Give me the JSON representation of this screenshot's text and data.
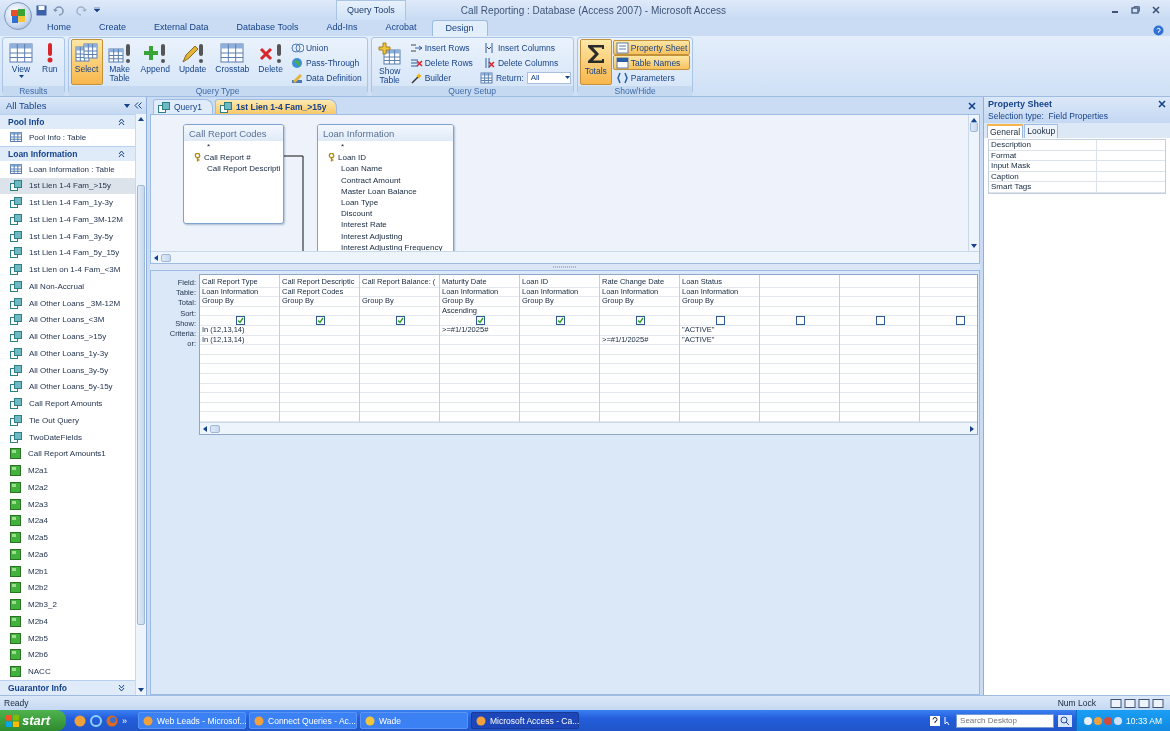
{
  "title_bar": {
    "title": "Call Reporting : Database (Access 2007) - Microsoft Access",
    "context_label": "Query Tools"
  },
  "ribbon": {
    "tabs": [
      {
        "label": "Home",
        "selected": false
      },
      {
        "label": "Create",
        "selected": false
      },
      {
        "label": "External Data",
        "selected": false
      },
      {
        "label": "Database Tools",
        "selected": false
      },
      {
        "label": "Add-Ins",
        "selected": false
      },
      {
        "label": "Acrobat",
        "selected": false
      },
      {
        "label": "Design",
        "selected": true
      }
    ],
    "groups": [
      {
        "label": "Results",
        "buttons": [
          {
            "kind": "large",
            "label": "View",
            "dropdown": true,
            "selected": false
          },
          {
            "kind": "large",
            "label": "Run",
            "selected": false
          }
        ]
      },
      {
        "label": "Query Type",
        "buttons": [
          {
            "kind": "large",
            "label": "Select",
            "selected": true
          },
          {
            "kind": "large",
            "label": "Make Table",
            "selected": false
          },
          {
            "kind": "large",
            "label": "Append",
            "selected": false
          },
          {
            "kind": "large",
            "label": "Update",
            "selected": false
          },
          {
            "kind": "large",
            "label": "Crosstab",
            "selected": false
          },
          {
            "kind": "large",
            "label": "Delete",
            "selected": false
          },
          {
            "kind": "small",
            "label": "Union",
            "selected": false
          },
          {
            "kind": "small",
            "label": "Pass-Through",
            "selected": false
          },
          {
            "kind": "small",
            "label": "Data Definition",
            "selected": false
          }
        ]
      },
      {
        "label": "Query Setup",
        "buttons": [
          {
            "kind": "large",
            "label": "Show Table",
            "selected": false
          },
          {
            "kind": "small",
            "label": "Insert Rows",
            "selected": false
          },
          {
            "kind": "small",
            "label": "Delete Rows",
            "selected": false
          },
          {
            "kind": "small",
            "label": "Builder",
            "selected": false
          },
          {
            "kind": "small",
            "label": "Insert Columns",
            "selected": false
          },
          {
            "kind": "small",
            "label": "Delete Columns",
            "selected": false
          },
          {
            "kind": "combo",
            "label": "Return:",
            "value": "All"
          }
        ]
      },
      {
        "label": "Show/Hide",
        "buttons": [
          {
            "kind": "large",
            "label": "Totals",
            "selected": true
          },
          {
            "kind": "small",
            "label": "Property Sheet",
            "selected": true
          },
          {
            "kind": "small",
            "label": "Table Names",
            "selected": true
          },
          {
            "kind": "small",
            "label": "Parameters",
            "selected": false
          }
        ]
      }
    ]
  },
  "nav": {
    "header": "All Tables",
    "groups": [
      {
        "label": "Pool Info",
        "expanded": true,
        "items": [
          {
            "label": "Pool Info : Table",
            "kind": "table",
            "selected": false
          }
        ]
      },
      {
        "label": "Loan Information",
        "expanded": true,
        "items": [
          {
            "label": "Loan Information : Table",
            "kind": "table",
            "selected": false
          },
          {
            "label": "1st Lien 1-4 Fam_>15y",
            "kind": "query",
            "selected": true
          },
          {
            "label": "1st Lien 1-4 Fam_1y-3y",
            "kind": "query",
            "selected": false
          },
          {
            "label": "1st Lien 1-4 Fam_3M-12M",
            "kind": "query",
            "selected": false
          },
          {
            "label": "1st Lien 1-4 Fam_3y-5y",
            "kind": "query",
            "selected": false
          },
          {
            "label": "1st Lien 1-4 Fam_5y_15y",
            "kind": "query",
            "selected": false
          },
          {
            "label": "1st Lien on 1-4 Fam_<3M",
            "kind": "query",
            "selected": false
          },
          {
            "label": "All Non-Accrual",
            "kind": "query",
            "selected": false
          },
          {
            "label": "All Other Loans _3M-12M",
            "kind": "query",
            "selected": false
          },
          {
            "label": "All Other Loans_<3M",
            "kind": "query",
            "selected": false
          },
          {
            "label": "All Other Loans_>15y",
            "kind": "query",
            "selected": false
          },
          {
            "label": "All Other Loans_1y-3y",
            "kind": "query",
            "selected": false
          },
          {
            "label": "All Other Loans_3y-5y",
            "kind": "query",
            "selected": false
          },
          {
            "label": "All Other Loans_5y-15y",
            "kind": "query",
            "selected": false
          },
          {
            "label": "Call Report Amounts",
            "kind": "query",
            "selected": false
          },
          {
            "label": "Tie Out Query",
            "kind": "query",
            "selected": false
          },
          {
            "label": "TwoDateFields",
            "kind": "query",
            "selected": false
          },
          {
            "label": "Call Report Amounts1",
            "kind": "report",
            "selected": false
          },
          {
            "label": "M2a1",
            "kind": "report",
            "selected": false
          },
          {
            "label": "M2a2",
            "kind": "report",
            "selected": false
          },
          {
            "label": "M2a3",
            "kind": "report",
            "selected": false
          },
          {
            "label": "M2a4",
            "kind": "report",
            "selected": false
          },
          {
            "label": "M2a5",
            "kind": "report",
            "selected": false
          },
          {
            "label": "M2a6",
            "kind": "report",
            "selected": false
          },
          {
            "label": "M2b1",
            "kind": "report",
            "selected": false
          },
          {
            "label": "M2b2",
            "kind": "report",
            "selected": false
          },
          {
            "label": "M2b3_2",
            "kind": "report",
            "selected": false
          },
          {
            "label": "M2b4",
            "kind": "report",
            "selected": false
          },
          {
            "label": "M2b5",
            "kind": "report",
            "selected": false
          },
          {
            "label": "M2b6",
            "kind": "report",
            "selected": false
          },
          {
            "label": "NACC",
            "kind": "report",
            "selected": false
          }
        ]
      },
      {
        "label": "Guarantor Info",
        "expanded": false
      }
    ]
  },
  "doc_tabs": [
    {
      "label": "Query1",
      "selected": false
    },
    {
      "label": "1st Lien 1-4 Fam_>15y",
      "selected": true
    }
  ],
  "field_lists": [
    {
      "title": "Call Report Codes",
      "fields": [
        {
          "name": "*",
          "key": false
        },
        {
          "name": "Call Report #",
          "key": true
        },
        {
          "name": "Call Report Descripti",
          "key": false
        }
      ]
    },
    {
      "title": "Loan Information",
      "fields": [
        {
          "name": "*",
          "key": false
        },
        {
          "name": "Loan ID",
          "key": true
        },
        {
          "name": "Loan Name",
          "key": false
        },
        {
          "name": "Contract Amount",
          "key": false
        },
        {
          "name": "Master Loan Balance",
          "key": false
        },
        {
          "name": "Loan Type",
          "key": false
        },
        {
          "name": "Discount",
          "key": false
        },
        {
          "name": "Interest Rate",
          "key": false
        },
        {
          "name": "Interest Adjusting",
          "key": false
        },
        {
          "name": "Interest Adjusting Frequency",
          "key": false
        }
      ]
    }
  ],
  "query_grid": {
    "row_labels": [
      "Field:",
      "Table:",
      "Total:",
      "Sort:",
      "Show:",
      "Criteria:",
      "or:"
    ],
    "columns": [
      {
        "field": "Call Report Type",
        "table": "Loan Information",
        "total": "Group By",
        "show": true,
        "criteria": "In (12,13,14)",
        "or": "In (12,13,14)"
      },
      {
        "field": "Call Report Descriptic",
        "table": "Call Report Codes",
        "total": "Group By",
        "show": true
      },
      {
        "field": "Call Report Balance: (",
        "total": "Group By",
        "show": true
      },
      {
        "field": "Maturity Date",
        "table": "Loan Information",
        "total": "Group By",
        "sort": "Ascending",
        "show": true,
        "criteria": ">=#1/1/2025#"
      },
      {
        "field": "Loan ID",
        "table": "Loan Information",
        "total": "Group By",
        "show": true
      },
      {
        "field": "Rate Change Date",
        "table": "Loan Information",
        "total": "Group By",
        "show": true,
        "or": ">=#1/1/2025#"
      },
      {
        "field": "Loan Status",
        "table": "Loan Information",
        "total": "Group By",
        "show": false,
        "criteria": "\"ACTIVE\"",
        "or": "\"ACTIVE\""
      },
      {
        "show": false
      },
      {
        "show": false
      },
      {
        "show": false
      }
    ]
  },
  "property_sheet": {
    "title": "Property Sheet",
    "selection_type": "Selection type:  Field Properties",
    "tabs": [
      {
        "label": "General",
        "selected": true
      },
      {
        "label": "Lookup",
        "selected": false
      }
    ],
    "rows": [
      "Description",
      "Format",
      "Input Mask",
      "Caption",
      "Smart Tags"
    ]
  },
  "status_bar": {
    "left": "Ready",
    "right": "Num Lock"
  },
  "taskbar": {
    "start": "start",
    "more": "»",
    "tasks": [
      {
        "label": "Web Leads - Microsof...",
        "selected": false
      },
      {
        "label": "Connect Queries - Ac...",
        "selected": false
      },
      {
        "label": "Wade",
        "selected": false
      },
      {
        "label": "Microsoft Access - Ca...",
        "selected": true
      }
    ],
    "search_placeholder": "Search Desktop",
    "clock": "10:33 AM"
  }
}
